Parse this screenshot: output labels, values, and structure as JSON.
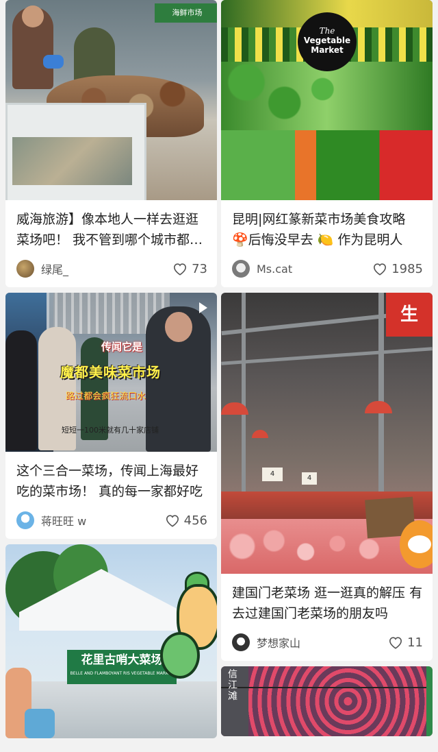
{
  "feed": {
    "cards": [
      {
        "title": "威海旅游】像本地人一样去逛逛菜场吧！ 我不管到哪个城市都喜欢逛菜场",
        "author": "绿尾_",
        "likes": "73",
        "image_text": "海鲜市场"
      },
      {
        "title": "昆明|网红篆新菜市场美食攻略 🍄后悔没早去 🍋 作为昆明人",
        "author": "Ms.cat",
        "likes": "1985",
        "logo_line1": "The",
        "logo_line2": "Vegetable",
        "logo_line3": "Market"
      },
      {
        "title": "这个三合一菜场，传闻上海最好吃的菜市场！ 真的每一家都好吃",
        "author": "蒋旺旺 w",
        "likes": "456",
        "caption1": "传闻它是",
        "caption2": "魔都美味菜市场",
        "caption3": "路过都会疯狂流口水",
        "caption4": "短短一100米就有几十家店铺"
      },
      {
        "title": "建国门老菜场 逛一逛真的解压 有去过建国门老菜场的朋友吗",
        "author": "梦想家山",
        "likes": "11",
        "sign": "生",
        "price1": "4",
        "price2": "4"
      },
      {
        "banner_main": "花里古哨大菜场",
        "banner_sub": "BELLE AND FLAMBOYANT RIS VEGETABLE MARKET"
      },
      {
        "mural_text": "信\n江\n滩"
      }
    ]
  },
  "icons": {
    "heart": "heart-outline-icon",
    "play": "play-icon"
  },
  "colors": {
    "background": "#f2f2f2",
    "card": "#ffffff",
    "text": "#222222",
    "meta": "#555555"
  }
}
